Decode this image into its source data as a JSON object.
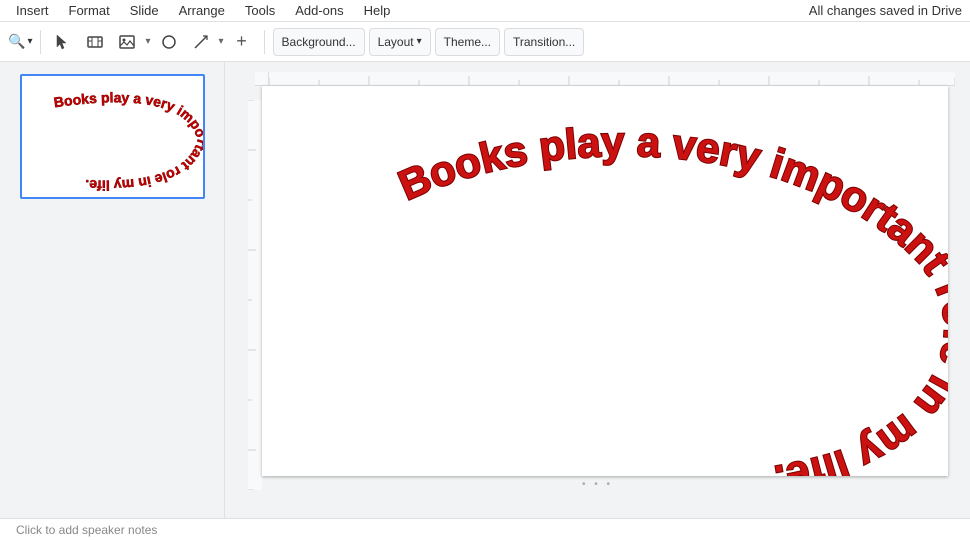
{
  "menu": {
    "items": [
      "Insert",
      "Format",
      "Slide",
      "Arrange",
      "Tools",
      "Add-ons",
      "Help"
    ],
    "drive_status": "All changes saved in Drive"
  },
  "toolbar": {
    "zoom_label": "⊖",
    "zoom_value": "Q",
    "background_label": "Background...",
    "layout_label": "Layout",
    "theme_label": "Theme...",
    "transition_label": "Transition...",
    "select_icon": "↖",
    "plus_icon": "+"
  },
  "slide": {
    "text": "Books play a very important role in my life.",
    "notes_placeholder": "Click to add speaker notes"
  },
  "bottom_dots": "• • •"
}
